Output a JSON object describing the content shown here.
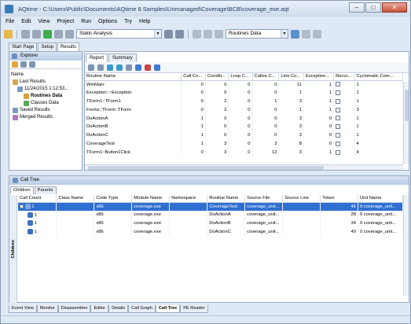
{
  "window": {
    "title": "AQtime - C:\\Users\\Public\\Documents\\AQtime 8 Samples\\Unmanaged\\Coverage\\BCB\\coverage_exe.aqt",
    "buttons": {
      "minimize": "–",
      "maximize": "□",
      "close": "✕"
    }
  },
  "menu": [
    "File",
    "Edit",
    "View",
    "Project",
    "Run",
    "Options",
    "Try",
    "Help"
  ],
  "toolbar": {
    "profiler_mode": "Static Analysis",
    "results_view": "Routines Data"
  },
  "doc_tabs": [
    "Start Page",
    "Setup",
    "Results"
  ],
  "explorer": {
    "title": "Explorer",
    "tree_header": "Name",
    "tree": [
      {
        "label": "Last Results"
      },
      {
        "label": "11/24/2015 1:12:53..."
      },
      {
        "label": "Routines Data"
      },
      {
        "label": "Classes Data"
      },
      {
        "label": "Saved Results"
      },
      {
        "label": "Merged Results"
      }
    ]
  },
  "report": {
    "tabs": [
      "Report",
      "Summary"
    ],
    "columns": [
      "Routine Name",
      "Call Co...",
      "Conditi...",
      "Loop C...",
      "Callee C...",
      "Line Co...",
      "Exception...",
      "Recur...",
      "Cyclomatic Com..."
    ],
    "rows": [
      [
        "WinMain",
        "0",
        "0",
        "0",
        "0",
        "11",
        "1",
        "",
        "1"
      ],
      [
        "Exception::~Exception",
        "0",
        "0",
        "0",
        "0",
        "1",
        "1",
        "",
        "1"
      ],
      [
        "TForm1::TForm1",
        "0",
        "2",
        "0",
        "1",
        "3",
        "1",
        "",
        "1"
      ],
      [
        "Forms::TForm::TForm",
        "0",
        "2",
        "0",
        "0",
        "1",
        "1",
        "",
        "3"
      ],
      [
        "DoActionA",
        "1",
        "0",
        "0",
        "0",
        "3",
        "0",
        "",
        "1"
      ],
      [
        "DoActionB",
        "1",
        "0",
        "0",
        "0",
        "3",
        "0",
        "",
        "1"
      ],
      [
        "DoActionC",
        "1",
        "0",
        "0",
        "0",
        "3",
        "0",
        "",
        "1"
      ],
      [
        "CoverageTest",
        "1",
        "3",
        "0",
        "3",
        "8",
        "0",
        "",
        "4"
      ],
      [
        "TForm1::Button1Click",
        "0",
        "3",
        "0",
        "12",
        "3",
        "1",
        "",
        "4"
      ]
    ]
  },
  "calltree": {
    "title": "Call Tree",
    "subtabs": [
      "Children",
      "Parents"
    ],
    "side_label": "Children",
    "columns": [
      "Call Count",
      "Class Name",
      "Code Type",
      "Module Name",
      "Namespace",
      "Routine Name",
      "Source File",
      "Source Line",
      "Token",
      "Unit Name"
    ],
    "rows": [
      [
        "1",
        "",
        "x86",
        "coverage.exe",
        "",
        "CoverageTest",
        "coverage_unit...",
        "",
        "46",
        "0 coverage_unit..."
      ],
      [
        "1",
        "",
        "x86",
        "coverage.exe",
        "",
        "DoActionA",
        "coverage_unit...",
        "",
        "28",
        "0 coverage_unit..."
      ],
      [
        "1",
        "",
        "x86",
        "coverage.exe",
        "",
        "DoActionB",
        "coverage_unit...",
        "",
        "34",
        "0 coverage_unit..."
      ],
      [
        "1",
        "",
        "x86",
        "coverage.exe",
        "",
        "DoActionC",
        "coverage_unit...",
        "",
        "40",
        "0 coverage_unit..."
      ]
    ]
  },
  "bottom_tabs": [
    "Event View",
    "Monitor",
    "Disassembler",
    "Editor",
    "Details",
    "Call Graph",
    "Call Tree",
    "PE Reader"
  ],
  "colors": {
    "selection": "#2f6fd1",
    "frame": "#dfe9f5"
  }
}
